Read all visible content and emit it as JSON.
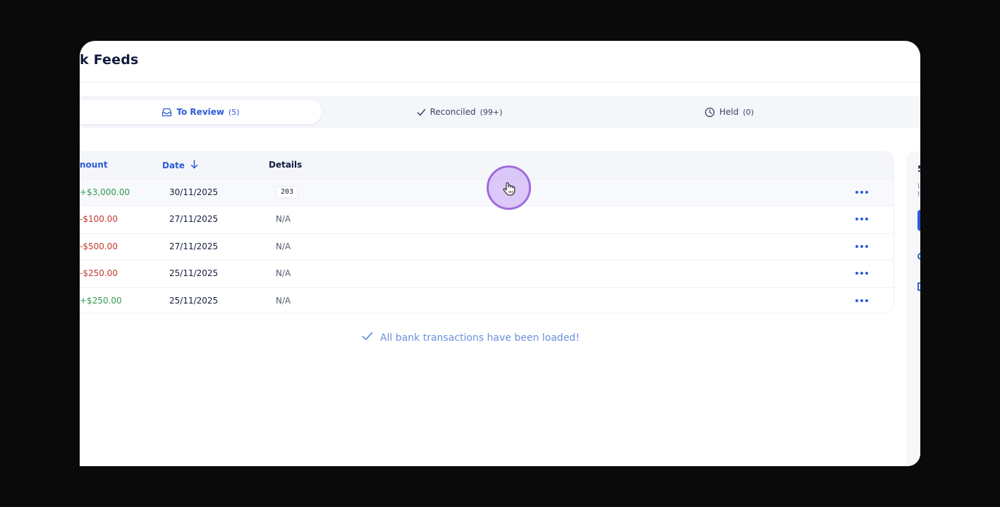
{
  "page": {
    "title": "k Feeds"
  },
  "tabs": [
    {
      "label": "To Review",
      "count": "(5)",
      "icon": "inbox-icon",
      "active": true
    },
    {
      "label": "Reconciled",
      "count": "(99+)",
      "icon": "check-icon",
      "active": false
    },
    {
      "label": "Held",
      "count": "(0)",
      "icon": "clock-icon",
      "active": false
    }
  ],
  "table": {
    "headers": {
      "amount": "nount",
      "date": "Date",
      "details": "Details"
    },
    "sort": {
      "column": "date",
      "direction": "descending",
      "icon": "arrow-down-icon"
    },
    "rows": [
      {
        "amount": "+$3,000.00",
        "type": "credit",
        "date": "30/11/2025",
        "details": "203"
      },
      {
        "amount": "-$100.00",
        "type": "debit",
        "date": "27/11/2025",
        "details": "N/A"
      },
      {
        "amount": "-$500.00",
        "type": "debit",
        "date": "27/11/2025",
        "details": "N/A"
      },
      {
        "amount": "-$250.00",
        "type": "debit",
        "date": "25/11/2025",
        "details": "N/A"
      },
      {
        "amount": "+$250.00",
        "type": "credit",
        "date": "25/11/2025",
        "details": "N/A"
      }
    ],
    "row_action_icon": "more-horizontal-icon"
  },
  "status": {
    "message": "All bank transactions have been loaded!",
    "icon": "check-icon"
  },
  "right_panel": {
    "number": "5",
    "line1": "L",
    "line2": "h"
  },
  "colors": {
    "accent": "#2a5bd7",
    "credit": "#2e9a4a",
    "debit": "#c0392b",
    "title": "#141c3d",
    "cursor_highlight": "#a06ae0"
  }
}
